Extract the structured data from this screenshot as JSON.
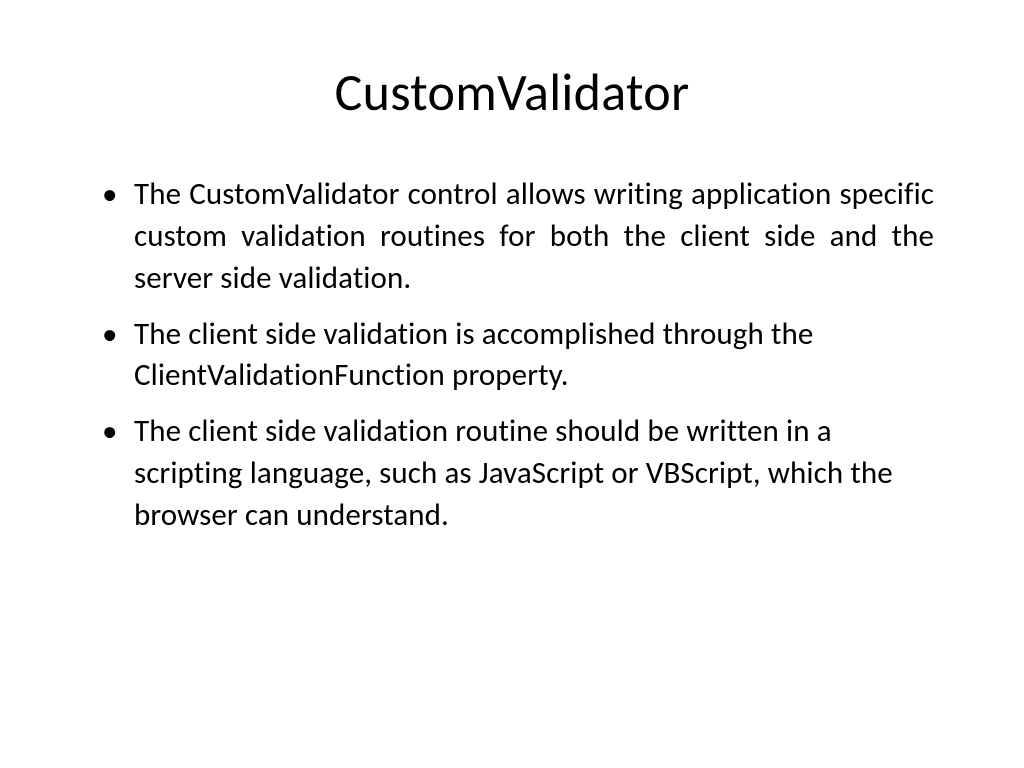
{
  "slide": {
    "title": "CustomValidator",
    "bullets": [
      "The CustomValidator control allows writing application specific custom validation routines for both the client side and the server side validation.",
      "The client side validation is accomplished through the ClientValidationFunction property.",
      "The client side validation routine should be written in a scripting language, such as JavaScript or VBScript, which the browser can understand."
    ]
  }
}
